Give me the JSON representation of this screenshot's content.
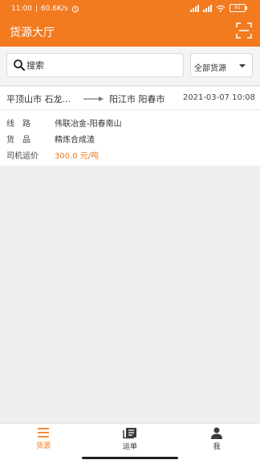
{
  "status": {
    "time": "11:00",
    "speed": "60.6K/s",
    "battery": "91",
    "icons": [
      "alarm-icon",
      "signal-icon",
      "signal-icon",
      "wifi-icon",
      "battery-icon"
    ]
  },
  "appbar": {
    "title": "货源大厅",
    "scan_icon": "scan-icon"
  },
  "search": {
    "placeholder": "搜索",
    "value": "",
    "filter_selected": "全部货源"
  },
  "listing": {
    "from": "平顶山市 石龙...",
    "to": "阳江市 阳春市",
    "date": "2021-03-07 10:08",
    "route_label": "线　路",
    "route_value": "伟联冶金-阳春南山",
    "goods_label": "货　品",
    "goods_value": "精炼合成渣",
    "price_label": "司机运价",
    "price_value": "300.0 元/吨"
  },
  "tabs": [
    {
      "label": "货源",
      "icon": "menu-icon",
      "active": true
    },
    {
      "label": "运单",
      "icon": "waybill-icon",
      "active": false
    },
    {
      "label": "我",
      "icon": "person-icon",
      "active": false
    }
  ],
  "colors": {
    "accent": "#f27a1f",
    "background": "#efefef"
  }
}
